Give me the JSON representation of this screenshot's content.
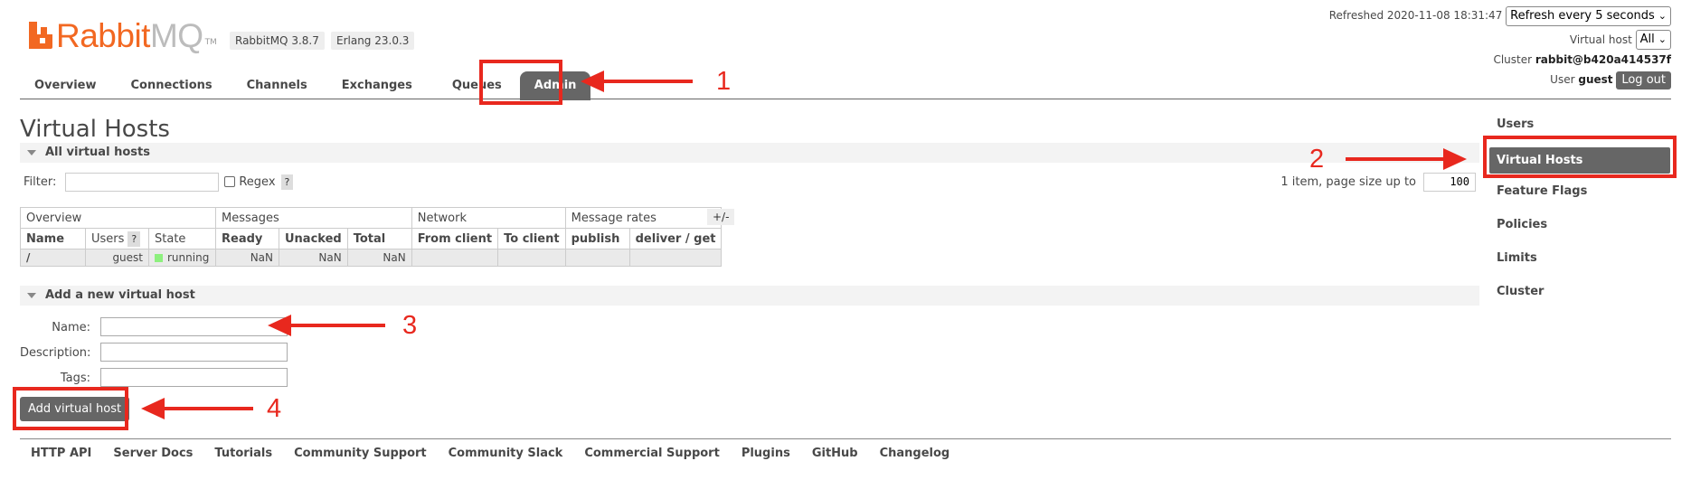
{
  "header": {
    "logo_rabbit": "Rabbit",
    "logo_mq": "MQ",
    "logo_tm": "TM",
    "rabbitmq_version": "RabbitMQ 3.8.7",
    "erlang_version": "Erlang 23.0.3",
    "refreshed_label": "Refreshed 2020-11-08 18:31:47",
    "refresh_select": "Refresh every 5 seconds",
    "virtual_host_label": "Virtual host",
    "virtual_host_select": "All",
    "cluster_label": "Cluster",
    "cluster_name": "rabbit@b420a414537f",
    "user_label": "User",
    "user_name": "guest",
    "logout_label": "Log out"
  },
  "tabs": [
    {
      "label": "Overview"
    },
    {
      "label": "Connections"
    },
    {
      "label": "Channels"
    },
    {
      "label": "Exchanges"
    },
    {
      "label": "Queues"
    },
    {
      "label": "Admin",
      "active": true
    }
  ],
  "page": {
    "title": "Virtual Hosts",
    "all_section": "All virtual hosts",
    "filter_label": "Filter:",
    "regex_label": "Regex",
    "help_q": "?",
    "paging_text": "1 item, page size up to",
    "page_size": "100",
    "plus_minus": "+/-",
    "add_section": "Add a new virtual host"
  },
  "table": {
    "groups": [
      "Overview",
      "Messages",
      "Network",
      "Message rates"
    ],
    "columns": [
      "Name",
      "Users",
      "State",
      "Ready",
      "Unacked",
      "Total",
      "From client",
      "To client",
      "publish",
      "deliver / get"
    ],
    "users_help": "?",
    "rows": [
      {
        "name": "/",
        "users": "guest",
        "state": "running",
        "ready": "NaN",
        "unacked": "NaN",
        "total": "NaN",
        "from_client": "",
        "to_client": "",
        "publish": "",
        "deliver_get": ""
      }
    ],
    "state_color": "#8df07e"
  },
  "form": {
    "name_label": "Name:",
    "name_value": "",
    "description_label": "Description:",
    "description_value": "",
    "tags_label": "Tags:",
    "tags_value": "",
    "submit_label": "Add virtual host"
  },
  "sidebar": [
    {
      "label": "Users"
    },
    {
      "label": "Virtual Hosts",
      "active": true
    },
    {
      "label": "Feature Flags"
    },
    {
      "label": "Policies"
    },
    {
      "label": "Limits"
    },
    {
      "label": "Cluster"
    }
  ],
  "footer": [
    "HTTP API",
    "Server Docs",
    "Tutorials",
    "Community Support",
    "Community Slack",
    "Commercial Support",
    "Plugins",
    "GitHub",
    "Changelog"
  ],
  "annotations": [
    "1",
    "2",
    "3",
    "4"
  ],
  "colors": {
    "brand": "#f26822",
    "annotation": "#e8281e",
    "active_tab": "#666666"
  }
}
